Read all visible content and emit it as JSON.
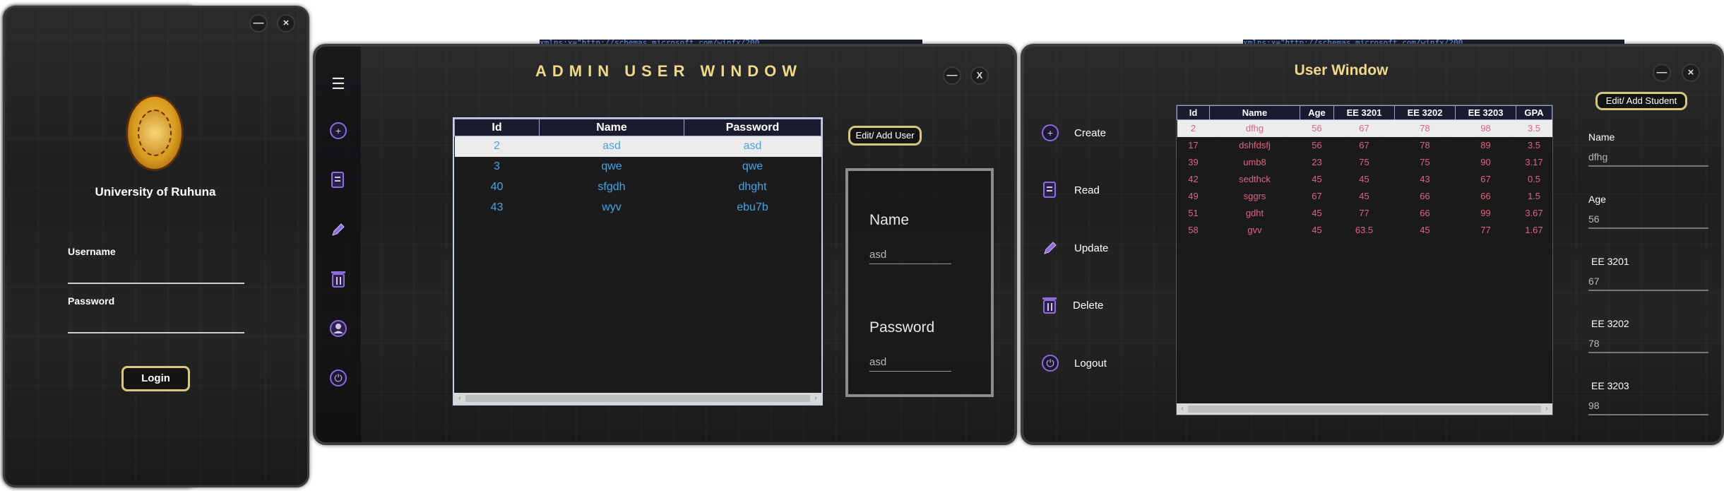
{
  "background": {
    "code_text": "xmlns:x=\"http://schemas.microsoft.com/winfx/200"
  },
  "login": {
    "university": "University of Ruhuna",
    "username_label": "Username",
    "password_label": "Password",
    "login_button": "Login",
    "minimize": "—",
    "close": "×"
  },
  "admin": {
    "title": "ADMIN USER WINDOW",
    "menu_icon": "☰",
    "minimize": "—",
    "close": "X",
    "columns": [
      "Id",
      "Name",
      "Password"
    ],
    "rows": [
      [
        "2",
        "asd",
        "asd"
      ],
      [
        "3",
        "qwe",
        "qwe"
      ],
      [
        "40",
        "sfgdh",
        "dhght"
      ],
      [
        "43",
        "wyv",
        "ebu7b"
      ]
    ],
    "edit_button": "Edit/ Add User",
    "form": {
      "name_label": "Name",
      "name_value": "asd",
      "password_label": "Password",
      "password_value": "asd"
    },
    "sidebar_icons": [
      "menu-icon",
      "create-icon",
      "read-icon",
      "update-icon",
      "delete-icon",
      "user-icon",
      "logout-icon"
    ],
    "accent_color": "#4aa3df"
  },
  "user": {
    "title": "User Window",
    "minimize": "—",
    "close": "×",
    "menu": [
      "Create",
      "Read",
      "Update",
      "Delete",
      "Logout"
    ],
    "columns": [
      "Id",
      "Name",
      "Age",
      "EE 3201",
      "EE 3202",
      "EE 3203",
      "GPA"
    ],
    "rows": [
      [
        "2",
        "dfhg",
        "56",
        "67",
        "78",
        "98",
        "3.5"
      ],
      [
        "17",
        "dshfdsfj",
        "56",
        "67",
        "78",
        "89",
        "3.5"
      ],
      [
        "39",
        "umb8",
        "23",
        "75",
        "75",
        "90",
        "3.17"
      ],
      [
        "42",
        "sedthck",
        "45",
        "45",
        "43",
        "67",
        "0.5"
      ],
      [
        "49",
        "sggrs",
        "67",
        "45",
        "66",
        "66",
        "1.5"
      ],
      [
        "51",
        "gdht",
        "45",
        "77",
        "66",
        "99",
        "3.67"
      ],
      [
        "58",
        "gvv",
        "45",
        "63.5",
        "45",
        "77",
        "1.67"
      ]
    ],
    "edit_button": "Edit/ Add Student",
    "fields": [
      {
        "label": "Name",
        "value": "dfhg"
      },
      {
        "label": "Age",
        "value": "56"
      },
      {
        "label": "EE 3201",
        "value": "67"
      },
      {
        "label": "EE 3202",
        "value": "78"
      },
      {
        "label": "EE 3203",
        "value": "98"
      }
    ],
    "row_color": "#e0637f"
  }
}
